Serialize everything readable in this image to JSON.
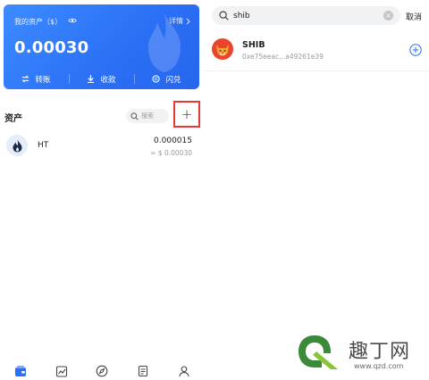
{
  "wallet": {
    "card_label": "我的资产（$）",
    "detail_label": "详情",
    "balance": "0.00030",
    "actions": [
      {
        "label": "转账",
        "icon": "transfer-icon"
      },
      {
        "label": "收款",
        "icon": "receive-icon"
      },
      {
        "label": "闪兑",
        "icon": "swap-icon"
      }
    ],
    "accent": "#2a6ff5"
  },
  "assets": {
    "title": "资产",
    "search_placeholder": "搜索",
    "add_symbol": "+",
    "highlight_color": "#e53935",
    "items": [
      {
        "symbol": "HT",
        "amount": "0.000015",
        "fiat": "≈ $ 0.00030",
        "icon": "ht-token-icon"
      }
    ]
  },
  "tabbar": {
    "items": [
      {
        "name": "wallet-tab",
        "icon": "wallet-icon",
        "active": true
      },
      {
        "name": "market-tab",
        "icon": "chart-icon",
        "active": false
      },
      {
        "name": "discover-tab",
        "icon": "compass-icon",
        "active": false
      },
      {
        "name": "news-tab",
        "icon": "document-icon",
        "active": false
      },
      {
        "name": "profile-tab",
        "icon": "user-icon",
        "active": false
      }
    ]
  },
  "token_search": {
    "query": "shib",
    "cancel_label": "取消",
    "results": [
      {
        "symbol": "SHIB",
        "address": "0xe75eeac...a49261e39",
        "icon": "shib-logo-icon"
      }
    ]
  },
  "watermark": {
    "brand": "趣丁网",
    "url": "www.qzd.com"
  }
}
